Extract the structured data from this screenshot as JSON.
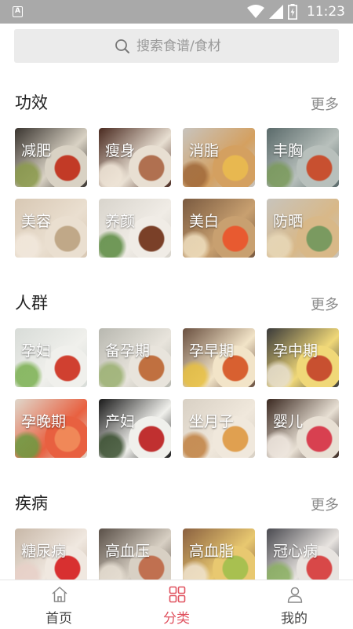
{
  "status_bar": {
    "time": "11:23",
    "app_badge": "A"
  },
  "search": {
    "placeholder": "搜索食谱/食材"
  },
  "sections": [
    {
      "title": "功效",
      "more": "更多",
      "tiles": [
        {
          "label": "减肥",
          "colors": [
            "#3a3530",
            "#d9d2c4",
            "#c23a26",
            "#8a9a4a"
          ]
        },
        {
          "label": "瘦身",
          "colors": [
            "#4a2a20",
            "#e8dfd2",
            "#b07050",
            "#f0e6d8"
          ]
        },
        {
          "label": "消脂",
          "colors": [
            "#c8c4be",
            "#d4a060",
            "#e8b850",
            "#a06838"
          ]
        },
        {
          "label": "丰胸",
          "colors": [
            "#5a6a6a",
            "#b8c0bc",
            "#c85030",
            "#7a9a5a"
          ]
        },
        {
          "label": "美容",
          "colors": [
            "#d8c8b4",
            "#eadfd0",
            "#c0a888",
            "#f2e8dc"
          ]
        },
        {
          "label": "养颜",
          "colors": [
            "#d8d4cc",
            "#f0ece6",
            "#7a4028",
            "#5a8a40"
          ]
        },
        {
          "label": "美白",
          "colors": [
            "#7a5a40",
            "#c8a070",
            "#e85a30",
            "#f0e0c0"
          ]
        },
        {
          "label": "防晒",
          "colors": [
            "#c8c4bc",
            "#d8b888",
            "#7a9a60",
            "#e8d8b8"
          ]
        }
      ]
    },
    {
      "title": "人群",
      "more": "更多",
      "tiles": [
        {
          "label": "孕妇",
          "colors": [
            "#d8dcd8",
            "#f0f0ec",
            "#d04030",
            "#7ab050"
          ]
        },
        {
          "label": "备孕期",
          "colors": [
            "#b8b8b0",
            "#e8e4dc",
            "#c07040",
            "#9ab070"
          ]
        },
        {
          "label": "孕早期",
          "colors": [
            "#6a5040",
            "#f2e4c8",
            "#d86030",
            "#e8c040"
          ]
        },
        {
          "label": "孕中期",
          "colors": [
            "#3a3a3a",
            "#f0d878",
            "#c85030",
            "#e8e0d0"
          ]
        },
        {
          "label": "孕晚期",
          "colors": [
            "#e0d8cc",
            "#e86040",
            "#f08858",
            "#6a9a40"
          ]
        },
        {
          "label": "产妇",
          "colors": [
            "#1a1a1a",
            "#f0f0ec",
            "#c03030",
            "#3a5030"
          ]
        },
        {
          "label": "坐月子",
          "colors": [
            "#d8d0c4",
            "#f0e8dc",
            "#e0a050",
            "#c08040"
          ]
        },
        {
          "label": "婴儿",
          "colors": [
            "#3a2820",
            "#e8e0d4",
            "#d84050",
            "#f0e8e0"
          ]
        }
      ]
    },
    {
      "title": "疾病",
      "more": "更多",
      "tiles": [
        {
          "label": "糖尿病",
          "colors": [
            "#c8b8a8",
            "#f0e8e0",
            "#d83030",
            "#e8d0c8"
          ]
        },
        {
          "label": "高血压",
          "colors": [
            "#5a5048",
            "#d8d0c4",
            "#c07050",
            "#e8e0d4"
          ]
        },
        {
          "label": "高血脂",
          "colors": [
            "#8a6040",
            "#e8c870",
            "#a8c050",
            "#f0e4d0"
          ]
        },
        {
          "label": "冠心病",
          "colors": [
            "#4a4a50",
            "#e8e4e0",
            "#d84848",
            "#8ab060"
          ]
        }
      ]
    }
  ],
  "bottom_nav": [
    {
      "label": "首页",
      "icon": "home-icon",
      "active": false
    },
    {
      "label": "分类",
      "icon": "category-grid-icon",
      "active": true
    },
    {
      "label": "我的",
      "icon": "user-icon",
      "active": false
    }
  ],
  "colors": {
    "accent": "#e0525f",
    "search_bg": "#ebebeb",
    "status_bar": "#a9a9a9"
  }
}
